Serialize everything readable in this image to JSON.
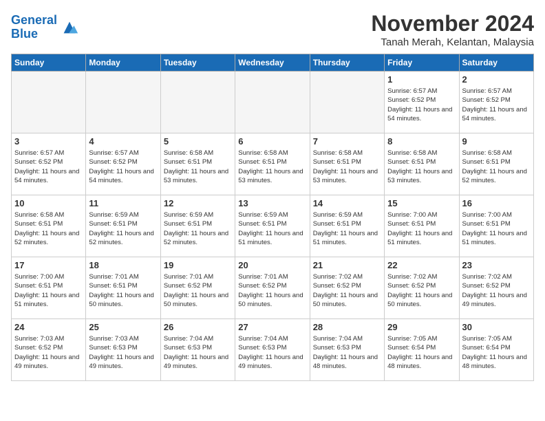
{
  "header": {
    "logo_line1": "General",
    "logo_line2": "Blue",
    "month": "November 2024",
    "location": "Tanah Merah, Kelantan, Malaysia"
  },
  "weekdays": [
    "Sunday",
    "Monday",
    "Tuesday",
    "Wednesday",
    "Thursday",
    "Friday",
    "Saturday"
  ],
  "weeks": [
    [
      {
        "day": "",
        "info": ""
      },
      {
        "day": "",
        "info": ""
      },
      {
        "day": "",
        "info": ""
      },
      {
        "day": "",
        "info": ""
      },
      {
        "day": "",
        "info": ""
      },
      {
        "day": "1",
        "info": "Sunrise: 6:57 AM\nSunset: 6:52 PM\nDaylight: 11 hours\nand 54 minutes."
      },
      {
        "day": "2",
        "info": "Sunrise: 6:57 AM\nSunset: 6:52 PM\nDaylight: 11 hours\nand 54 minutes."
      }
    ],
    [
      {
        "day": "3",
        "info": "Sunrise: 6:57 AM\nSunset: 6:52 PM\nDaylight: 11 hours\nand 54 minutes."
      },
      {
        "day": "4",
        "info": "Sunrise: 6:57 AM\nSunset: 6:52 PM\nDaylight: 11 hours\nand 54 minutes."
      },
      {
        "day": "5",
        "info": "Sunrise: 6:58 AM\nSunset: 6:51 PM\nDaylight: 11 hours\nand 53 minutes."
      },
      {
        "day": "6",
        "info": "Sunrise: 6:58 AM\nSunset: 6:51 PM\nDaylight: 11 hours\nand 53 minutes."
      },
      {
        "day": "7",
        "info": "Sunrise: 6:58 AM\nSunset: 6:51 PM\nDaylight: 11 hours\nand 53 minutes."
      },
      {
        "day": "8",
        "info": "Sunrise: 6:58 AM\nSunset: 6:51 PM\nDaylight: 11 hours\nand 53 minutes."
      },
      {
        "day": "9",
        "info": "Sunrise: 6:58 AM\nSunset: 6:51 PM\nDaylight: 11 hours\nand 52 minutes."
      }
    ],
    [
      {
        "day": "10",
        "info": "Sunrise: 6:58 AM\nSunset: 6:51 PM\nDaylight: 11 hours\nand 52 minutes."
      },
      {
        "day": "11",
        "info": "Sunrise: 6:59 AM\nSunset: 6:51 PM\nDaylight: 11 hours\nand 52 minutes."
      },
      {
        "day": "12",
        "info": "Sunrise: 6:59 AM\nSunset: 6:51 PM\nDaylight: 11 hours\nand 52 minutes."
      },
      {
        "day": "13",
        "info": "Sunrise: 6:59 AM\nSunset: 6:51 PM\nDaylight: 11 hours\nand 51 minutes."
      },
      {
        "day": "14",
        "info": "Sunrise: 6:59 AM\nSunset: 6:51 PM\nDaylight: 11 hours\nand 51 minutes."
      },
      {
        "day": "15",
        "info": "Sunrise: 7:00 AM\nSunset: 6:51 PM\nDaylight: 11 hours\nand 51 minutes."
      },
      {
        "day": "16",
        "info": "Sunrise: 7:00 AM\nSunset: 6:51 PM\nDaylight: 11 hours\nand 51 minutes."
      }
    ],
    [
      {
        "day": "17",
        "info": "Sunrise: 7:00 AM\nSunset: 6:51 PM\nDaylight: 11 hours\nand 51 minutes."
      },
      {
        "day": "18",
        "info": "Sunrise: 7:01 AM\nSunset: 6:51 PM\nDaylight: 11 hours\nand 50 minutes."
      },
      {
        "day": "19",
        "info": "Sunrise: 7:01 AM\nSunset: 6:52 PM\nDaylight: 11 hours\nand 50 minutes."
      },
      {
        "day": "20",
        "info": "Sunrise: 7:01 AM\nSunset: 6:52 PM\nDaylight: 11 hours\nand 50 minutes."
      },
      {
        "day": "21",
        "info": "Sunrise: 7:02 AM\nSunset: 6:52 PM\nDaylight: 11 hours\nand 50 minutes."
      },
      {
        "day": "22",
        "info": "Sunrise: 7:02 AM\nSunset: 6:52 PM\nDaylight: 11 hours\nand 50 minutes."
      },
      {
        "day": "23",
        "info": "Sunrise: 7:02 AM\nSunset: 6:52 PM\nDaylight: 11 hours\nand 49 minutes."
      }
    ],
    [
      {
        "day": "24",
        "info": "Sunrise: 7:03 AM\nSunset: 6:52 PM\nDaylight: 11 hours\nand 49 minutes."
      },
      {
        "day": "25",
        "info": "Sunrise: 7:03 AM\nSunset: 6:53 PM\nDaylight: 11 hours\nand 49 minutes."
      },
      {
        "day": "26",
        "info": "Sunrise: 7:04 AM\nSunset: 6:53 PM\nDaylight: 11 hours\nand 49 minutes."
      },
      {
        "day": "27",
        "info": "Sunrise: 7:04 AM\nSunset: 6:53 PM\nDaylight: 11 hours\nand 49 minutes."
      },
      {
        "day": "28",
        "info": "Sunrise: 7:04 AM\nSunset: 6:53 PM\nDaylight: 11 hours\nand 48 minutes."
      },
      {
        "day": "29",
        "info": "Sunrise: 7:05 AM\nSunset: 6:54 PM\nDaylight: 11 hours\nand 48 minutes."
      },
      {
        "day": "30",
        "info": "Sunrise: 7:05 AM\nSunset: 6:54 PM\nDaylight: 11 hours\nand 48 minutes."
      }
    ]
  ]
}
